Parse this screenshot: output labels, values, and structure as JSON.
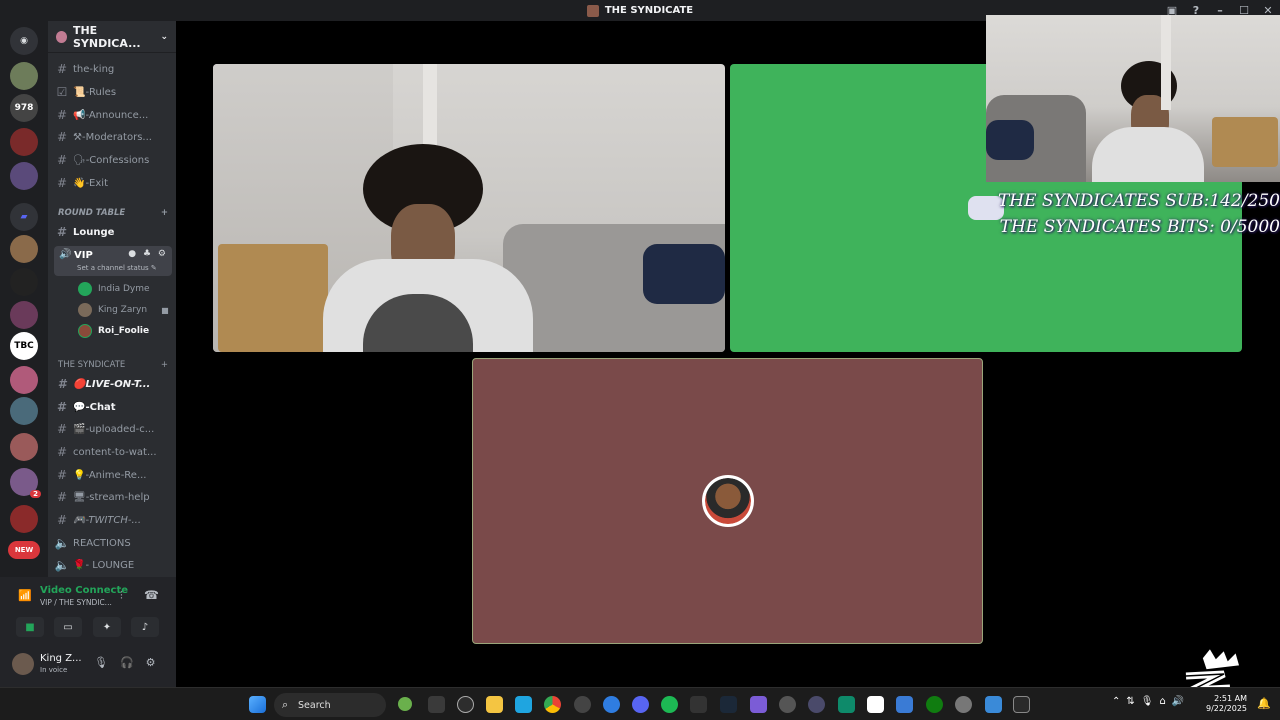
{
  "window": {
    "title": "THE SYNDICATE",
    "controls": [
      "inbox-icon",
      "help-icon",
      "minimize",
      "maximize",
      "close"
    ]
  },
  "guild_rail": [
    {
      "name": "discord-home",
      "label": ""
    },
    {
      "name": "server-1",
      "label": ""
    },
    {
      "name": "server-978",
      "label": "978"
    },
    {
      "name": "server-3",
      "label": ""
    },
    {
      "name": "server-4",
      "label": ""
    },
    {
      "name": "folder",
      "label": ""
    },
    {
      "name": "server-6",
      "label": ""
    },
    {
      "name": "server-7",
      "label": ""
    },
    {
      "name": "server-8",
      "label": ""
    },
    {
      "name": "server-tbc",
      "label": "TBC"
    },
    {
      "name": "server-10",
      "label": ""
    },
    {
      "name": "server-11",
      "label": ""
    },
    {
      "name": "server-12",
      "label": ""
    },
    {
      "name": "server-13",
      "label": "2"
    },
    {
      "name": "server-14",
      "label": ""
    },
    {
      "name": "new-badge",
      "label": "NEW"
    }
  ],
  "server": {
    "name": "THE SYNDICA..."
  },
  "channels_top": [
    "the-king",
    "📜-Rules",
    "📢-Announce...",
    "⚒-Moderators...",
    "🗣-Confessions",
    "👋-Exit"
  ],
  "category_round_table": "ROUND TABLE",
  "lounge": "Lounge",
  "vip": {
    "name": "VIP",
    "status": "Set a channel status ✎"
  },
  "voice_members": [
    {
      "name": "India Dyme",
      "bold": false
    },
    {
      "name": "King Zaryn",
      "bold": false
    },
    {
      "name": "Roi_Foolie",
      "bold": true
    }
  ],
  "category_syndicate": "THE SYNDICATE",
  "channels_bottom": [
    {
      "label": "🔴LIVE-ON-T...",
      "bold": true,
      "italic": true
    },
    {
      "label": "💬-Chat",
      "bold": true,
      "italic": false
    },
    {
      "label": "🎬-uploaded-c...",
      "bold": false,
      "italic": false
    },
    {
      "label": "content-to-wat...",
      "bold": false,
      "italic": false
    },
    {
      "label": "💡-Anime-Re...",
      "bold": false,
      "italic": false
    },
    {
      "label": "🖥-stream-help",
      "bold": false,
      "italic": false
    },
    {
      "label": "🎮-TWITCH-...",
      "bold": false,
      "italic": true
    },
    {
      "label": "REACTIONS",
      "bold": false,
      "italic": false
    },
    {
      "label": "🌹- LOUNGE",
      "bold": false,
      "italic": false
    }
  ],
  "voice_panel": {
    "title": "Video Connecte",
    "subtitle": "VIP / THE SYNDIC...",
    "user": "King Z...",
    "user_status": "In voice"
  },
  "overlay": {
    "line1": "THE SYNDICATES SUB:142/250",
    "line2": "THE SYNDICATES BITS: 0/5000"
  },
  "taskbar": {
    "search_label": "Search",
    "time": "2:51 AM",
    "date": "9/22/2025"
  },
  "colors": {
    "green_tile": "#3fb35b",
    "brown_tile": "#7a4a4a",
    "sidebar": "#2b2d31"
  }
}
